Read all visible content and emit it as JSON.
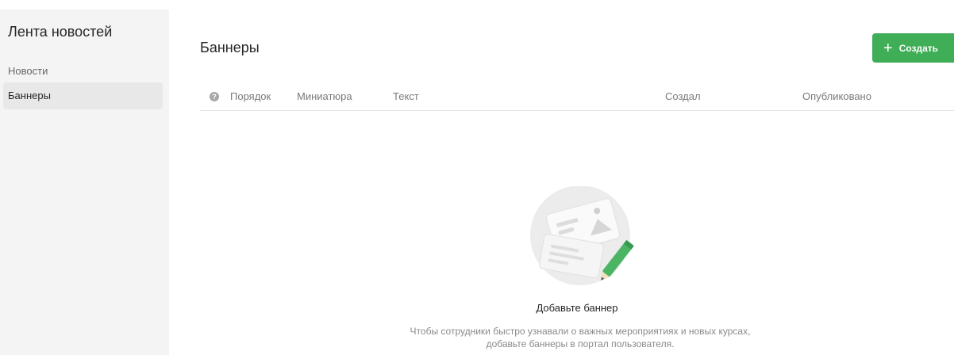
{
  "sidebar": {
    "title": "Лента новостей",
    "items": [
      {
        "label": "Новости",
        "active": false
      },
      {
        "label": "Баннеры",
        "active": true
      }
    ]
  },
  "header": {
    "title": "Баннеры",
    "create_label": "Создать",
    "create_icon": "plus-icon"
  },
  "table": {
    "help_icon": "question-icon",
    "columns": [
      "Порядок",
      "Миниатюра",
      "Текст",
      "Создал",
      "Опубликовано"
    ]
  },
  "empty_state": {
    "title": "Добавьте баннер",
    "text": "Чтобы сотрудники быстро узнавали о важных мероприятиях и новых курсах, добавьте баннеры в портал пользователя.",
    "illustration_icon": "banner-pencil-illustration"
  },
  "colors": {
    "accent": "#3fae56",
    "sidebar_bg": "#f4f4f4",
    "active_item_bg": "#e8e8e8"
  }
}
